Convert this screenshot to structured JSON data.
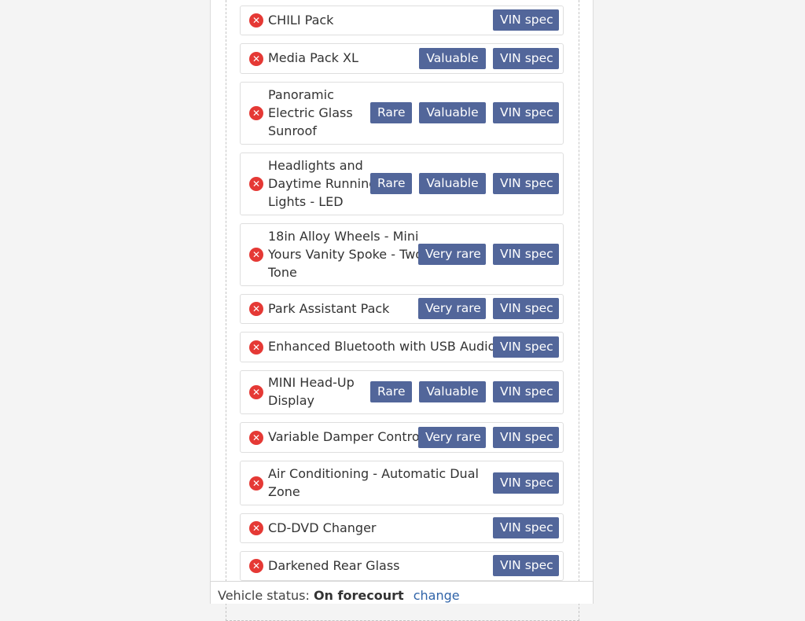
{
  "options": [
    {
      "label_lines": [
        "CHILI Pack"
      ],
      "tags": [
        "VIN spec"
      ]
    },
    {
      "label_lines": [
        "Media Pack XL"
      ],
      "tags": [
        "Valuable",
        "VIN spec"
      ]
    },
    {
      "label_lines": [
        "Panoramic",
        "Electric Glass",
        "Sunroof"
      ],
      "tags": [
        "Rare",
        "Valuable",
        "VIN spec"
      ]
    },
    {
      "label_lines": [
        "Headlights and",
        "Daytime Running",
        "Lights - LED"
      ],
      "tags": [
        "Rare",
        "Valuable",
        "VIN spec"
      ]
    },
    {
      "label_lines": [
        "18in Alloy Wheels - Mini",
        "Yours Vanity Spoke - Two-",
        "Tone"
      ],
      "tags": [
        "Very rare",
        "VIN spec"
      ]
    },
    {
      "label_lines": [
        "Park Assistant Pack"
      ],
      "tags": [
        "Very rare",
        "VIN spec"
      ]
    },
    {
      "label_lines": [
        "Enhanced Bluetooth with USB Audio"
      ],
      "tags": [
        "VIN spec"
      ]
    },
    {
      "label_lines": [
        "MINI Head-Up",
        "Display"
      ],
      "tags": [
        "Rare",
        "Valuable",
        "VIN spec"
      ]
    },
    {
      "label_lines": [
        "Variable Damper Control"
      ],
      "tags": [
        "Very rare",
        "VIN spec"
      ]
    },
    {
      "label_lines": [
        "Air Conditioning - Automatic Dual",
        "Zone"
      ],
      "tags": [
        "VIN spec"
      ]
    },
    {
      "label_lines": [
        "CD-DVD Changer"
      ],
      "tags": [
        "VIN spec"
      ]
    },
    {
      "label_lines": [
        "Darkened Rear Glass"
      ],
      "tags": [
        "VIN spec"
      ]
    }
  ],
  "icons": {
    "remove": "close-circle-icon",
    "remove_glyph": "✕"
  },
  "status": {
    "prefix": "Vehicle status:",
    "value": "On forecourt",
    "change_label": "change"
  },
  "colors": {
    "tag_background": "#52669a",
    "remove_icon": "#e53935",
    "link": "#2f63a8"
  }
}
